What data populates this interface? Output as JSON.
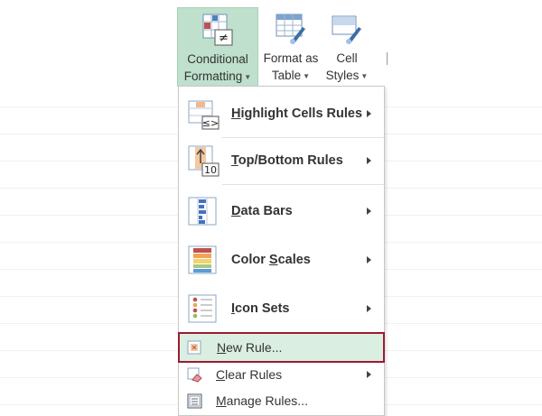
{
  "ribbon": {
    "conditional_formatting": {
      "line1": "Conditional",
      "line2": "Formatting"
    },
    "format_as_table": {
      "line1": "Format as",
      "line2": "Table"
    },
    "cell_styles": {
      "line1": "Cell",
      "line2": "Styles"
    }
  },
  "menu": {
    "items": [
      {
        "pre": "",
        "key": "H",
        "post": "ighlight Cells Rules",
        "submenu": true
      },
      {
        "pre": "",
        "key": "T",
        "post": "op/Bottom Rules",
        "submenu": true
      },
      {
        "pre": "",
        "key": "D",
        "post": "ata Bars",
        "submenu": true
      },
      {
        "pre": "Color ",
        "key": "S",
        "post": "cales",
        "submenu": true
      },
      {
        "pre": "",
        "key": "I",
        "post": "con Sets",
        "submenu": true
      },
      {
        "pre": "",
        "key": "N",
        "post": "ew Rule...",
        "submenu": false,
        "highlighted": true
      },
      {
        "pre": "",
        "key": "C",
        "post": "lear Rules",
        "submenu": true
      },
      {
        "pre": "",
        "key": "M",
        "post": "anage Rules...",
        "submenu": false
      }
    ],
    "top_bottom_badge": "10"
  },
  "colors": {
    "active_button": "#bfe0cc",
    "highlight_border": "#9b1b30",
    "highlight_fill": "#daeee1"
  }
}
